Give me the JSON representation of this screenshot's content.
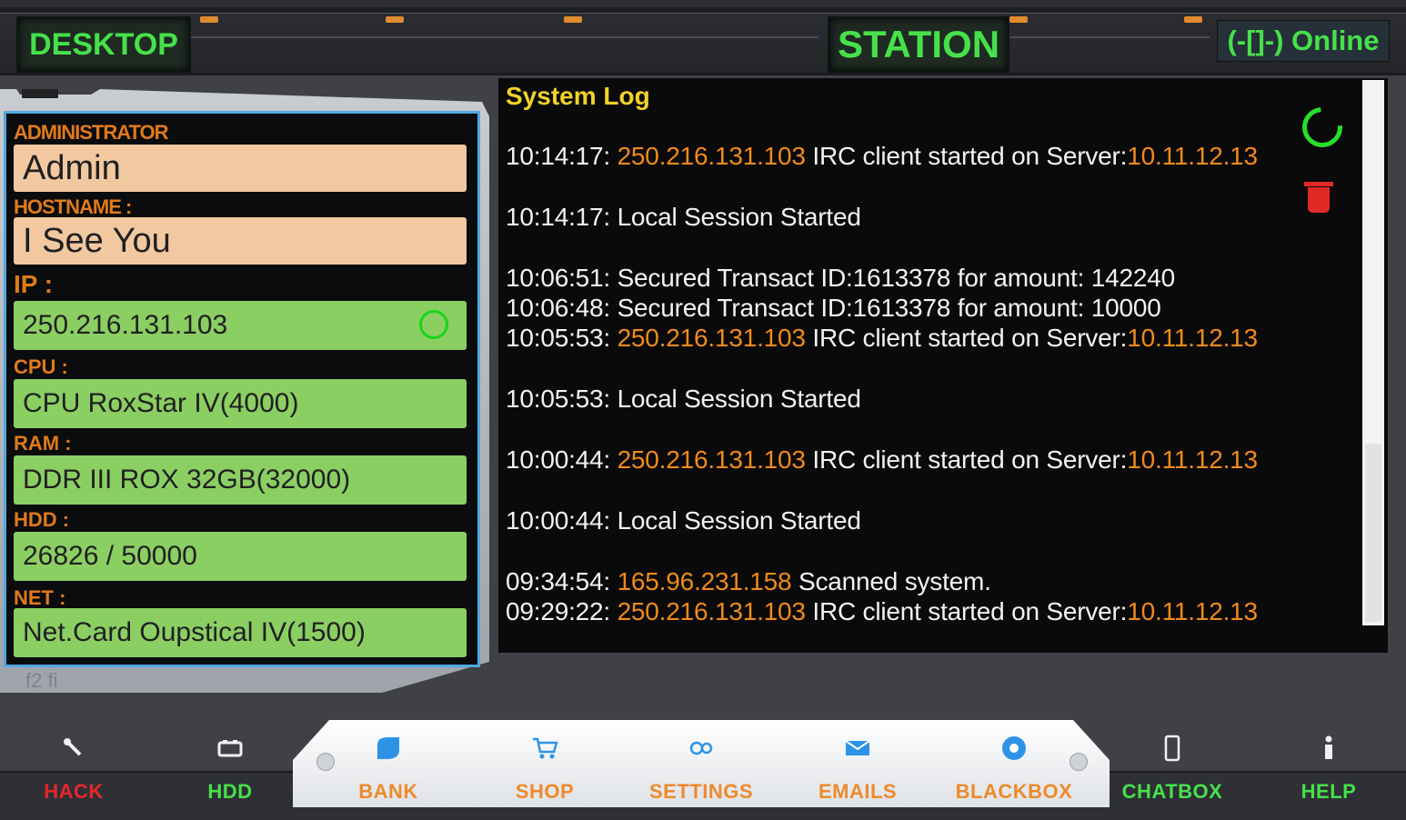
{
  "topbar": {
    "desktop_tab": "DESKTOP",
    "station_tab": "STATION",
    "online_status": "(-[]-) Online"
  },
  "info_panel": {
    "administrator_label": "ADMINISTRATOR",
    "administrator_value": "Admin",
    "hostname_label": "HOSTNAME :",
    "hostname_value": "I See You",
    "ip_label": "IP :",
    "ip_value": "250.216.131.103",
    "cpu_label": "CPU :",
    "cpu_value": "CPU RoxStar IV(4000)",
    "ram_label": "RAM :",
    "ram_value": "DDR III ROX 32GB(32000)",
    "hdd_label": "HDD :",
    "hdd_value": "26826 / 50000",
    "net_label": "NET :",
    "net_value": "Net.Card Oupstical IV(1500)",
    "footer_text": "f2    fi"
  },
  "system_log": {
    "title": "System Log",
    "entries": [
      {
        "time": "10:14:17:",
        "ip": "250.216.131.103",
        "text": " IRC client started on Server:",
        "server": "10.11.12.13"
      },
      {
        "time": "10:14:17:",
        "ip": "",
        "text": " Local Session Started",
        "server": ""
      },
      {
        "time": "10:06:51:",
        "ip": "",
        "text": " Secured Transact ID:1613378 for amount: 142240",
        "server": ""
      },
      {
        "time": "10:06:48:",
        "ip": "",
        "text": " Secured Transact ID:1613378 for amount: 10000",
        "server": ""
      },
      {
        "time": "10:05:53:",
        "ip": "250.216.131.103",
        "text": " IRC client started on Server:",
        "server": "10.11.12.13"
      },
      {
        "time": "10:05:53:",
        "ip": "",
        "text": " Local Session Started",
        "server": ""
      },
      {
        "time": "10:00:44:",
        "ip": "250.216.131.103",
        "text": " IRC client started on Server:",
        "server": "10.11.12.13"
      },
      {
        "time": "10:00:44:",
        "ip": "",
        "text": " Local Session Started",
        "server": ""
      },
      {
        "time": "09:34:54:",
        "ip": "165.96.231.158",
        "text": " Scanned system.",
        "server": ""
      },
      {
        "time": "09:29:22:",
        "ip": "250.216.131.103",
        "text": " IRC client started on Server:",
        "server": "10.11.12.13"
      }
    ],
    "refresh_icon": "refresh-icon",
    "trash_icon": "trash-icon"
  },
  "nav": {
    "hack": "HACK",
    "hdd": "HDD",
    "bank": "BANK",
    "shop": "SHOP",
    "settings": "SETTINGS",
    "emails": "EMAILS",
    "blackbox": "BLACKBOX",
    "chatbox": "CHATBOX",
    "help": "HELP"
  },
  "colors": {
    "accent_green": "#46e14a",
    "accent_orange": "#f08a1c",
    "log_title_yellow": "#f2d22a",
    "field_green": "#8bcf63",
    "field_peach": "#f2c8a0",
    "hack_red": "#e8262a"
  }
}
